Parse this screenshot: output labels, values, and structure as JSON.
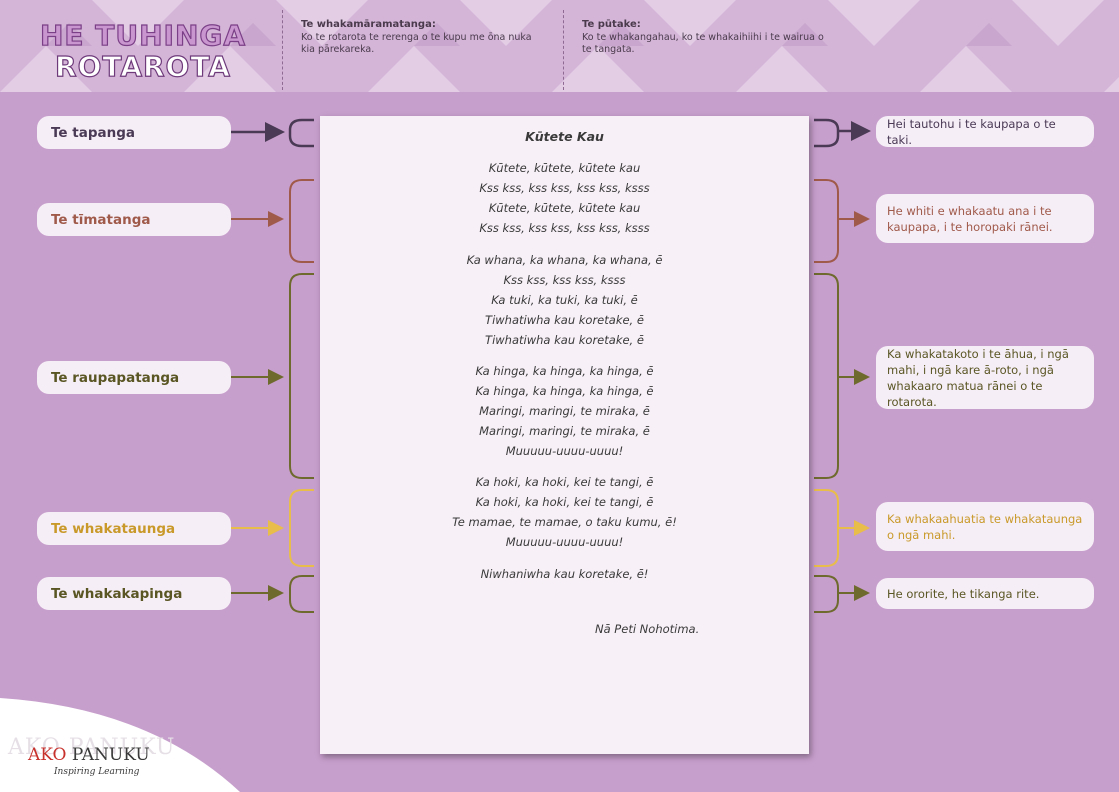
{
  "header": {
    "title_line1": "HE TUHINGA",
    "title_line2": "ROTAROTA",
    "definition_heading": "Te whakamāramatanga:",
    "definition_text": "Ko te rotarota te rerenga o te kupu me ōna nuka kia pārekareka.",
    "purpose_heading": "Te pūtake:",
    "purpose_text": "Ko te whakangahau, ko te whakaihiihi i te wairua o te tangata."
  },
  "sections": [
    {
      "label": "Te tapanga",
      "note": "Hei tautohu i te kaupapa o te taki.",
      "color": "#4a3a55"
    },
    {
      "label": "Te tīmatanga",
      "note": "He whiti e whakaatu ana i te kaupapa, i te horopaki rānei.",
      "color": "#a05a4a"
    },
    {
      "label": "Te raupapatanga",
      "note": "Ka whakatakoto i te āhua, i ngā mahi, i ngā kare ā-roto, i ngā whakaaro matua rānei o te rotarota.",
      "color": "#6e6a2e"
    },
    {
      "label": "Te whakataunga",
      "note": "Ka whakaahuatia te whakataunga o ngā mahi.",
      "color": "#d6a83a"
    },
    {
      "label": "Te whakakapinga",
      "note": "He ororite, he tikanga rite.",
      "color": "#6e6a2e"
    }
  ],
  "poem": {
    "title": "Kūtete Kau",
    "stanzas": [
      [
        "Kūtete, kūtete, kūtete kau",
        "Kss kss, kss kss, kss kss, ksss",
        "Kūtete, kūtete, kūtete kau",
        "Kss kss, kss kss, kss kss, ksss"
      ],
      [
        "Ka whana, ka whana, ka whana, ē",
        "Kss kss, kss kss, ksss",
        "Ka tuki, ka tuki, ka tuki, ē",
        "Tiwhatiwha kau koretake, ē",
        "Tiwhatiwha kau koretake, ē"
      ],
      [
        "Ka hinga, ka hinga, ka hinga, ē",
        "Ka hinga, ka hinga, ka hinga, ē",
        "Maringi, maringi, te miraka, ē",
        "Maringi, maringi, te miraka, ē",
        "Muuuuu-uuuu-uuuu!"
      ],
      [
        "Ka hoki, ka hoki, kei te tangi, ē",
        "Ka hoki, ka hoki, kei te tangi, ē",
        "Te mamae, te mamae, o taku kumu, ē!",
        "Muuuuu-uuuu-uuuu!"
      ],
      [
        "Niwhaniwha kau koretake, ē!"
      ]
    ],
    "author": "Nā Peti Nohotima."
  },
  "logo": {
    "ghost": "AKO PANUKU",
    "ako": "AKO",
    "panuku": "PANUKU",
    "tagline": "Inspiring Learning"
  }
}
